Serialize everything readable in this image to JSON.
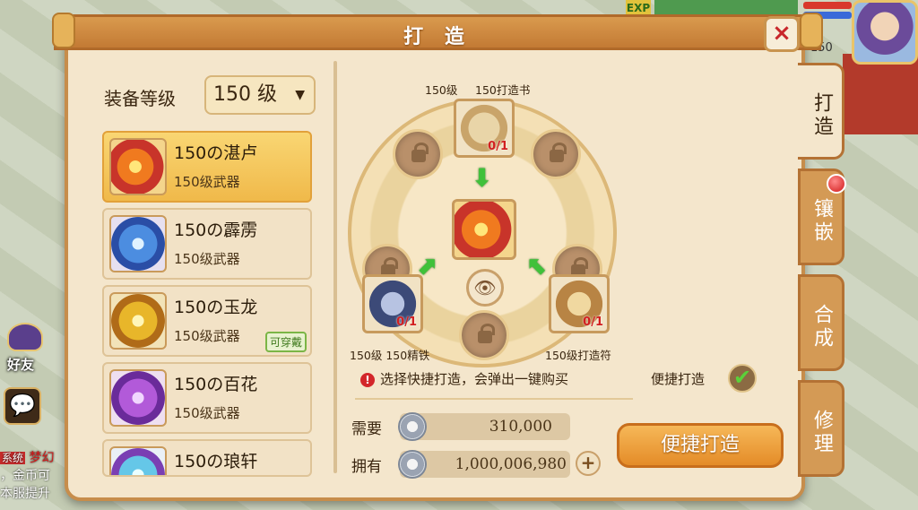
{
  "title": "打 造",
  "close_icon": "×",
  "hud": {
    "exp_label": "EXP",
    "player_level": "150"
  },
  "level_select": {
    "label": "装备等级",
    "value": "150  级",
    "arrow": "▼"
  },
  "items": [
    {
      "name": "150の湛卢",
      "sub": "150级武器",
      "selected": true,
      "icon": "fire-weapon-icon"
    },
    {
      "name": "150の霹雳",
      "sub": "150级武器",
      "selected": false,
      "icon": "blue-dragon-icon"
    },
    {
      "name": "150の玉龙",
      "sub": "150级武器",
      "selected": false,
      "icon": "gold-weapon-icon",
      "badge": "可穿戴"
    },
    {
      "name": "150の百花",
      "sub": "150级武器",
      "selected": false,
      "icon": "purple-whip-icon"
    },
    {
      "name": "150の琅轩",
      "sub": "",
      "selected": false,
      "icon": "cyan-orb-icon"
    }
  ],
  "materials": {
    "book": {
      "caption_level": "150级",
      "caption_name": "150打造书",
      "count": "0/1"
    },
    "iron": {
      "caption": "150级 150精铁",
      "count": "0/1"
    },
    "talisman": {
      "caption": "150级打造符",
      "count": "0/1"
    }
  },
  "tip": "选择快捷打造，会弹出一键购买",
  "tip_icon": "!",
  "quick_forge_label": "便捷打造",
  "check_mark": "✔",
  "eye_icon": "👁",
  "arrows": {
    "down": "⬇",
    "left_up": "⬈",
    "right_up": "⬉"
  },
  "need": {
    "label": "需要",
    "value": "310,000"
  },
  "own": {
    "label": "拥有",
    "value": "1,000,006,980"
  },
  "plus": "+",
  "forge_button": "便捷打造",
  "tabs": [
    "打造",
    "镶嵌",
    "合成",
    "修理"
  ],
  "sidebar": {
    "friend_label": "好友",
    "chat_icon": "💬"
  },
  "chat_lines": [
    "系统",
    "梦幻",
    "，金币可",
    "本服提升"
  ],
  "colors": {
    "panel": "#f4e6cc",
    "tab": "#d49a55",
    "button": "#e48c28",
    "accent_red": "#d11a1a",
    "accent_green": "#3fc13a"
  }
}
